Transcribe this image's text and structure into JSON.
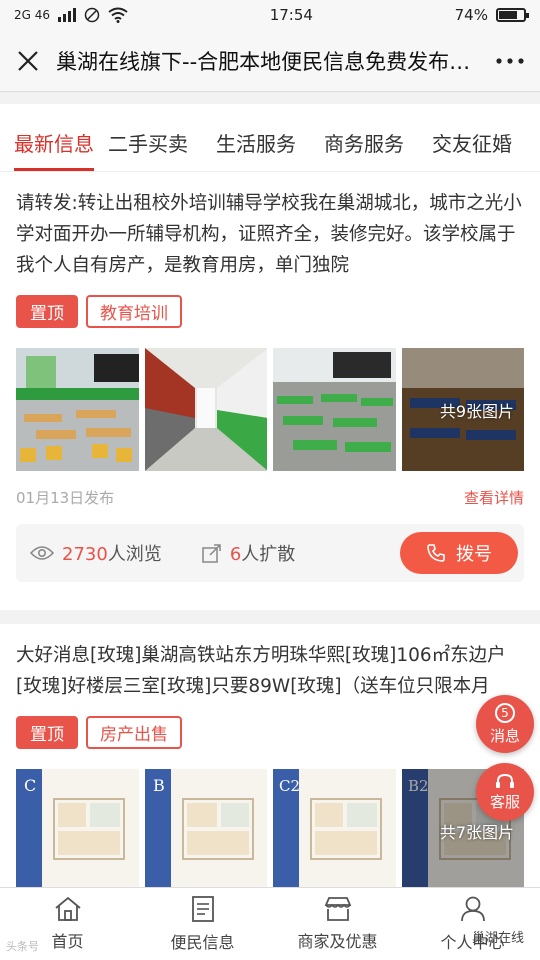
{
  "status": {
    "carrier": "2G 46",
    "time": "17:54",
    "battery": "74%",
    "battery_level": 0.74
  },
  "header": {
    "title": "巢湖在线旗下--合肥本地便民信息免费发布平台",
    "close_icon": "close-icon",
    "more_icon": "more-icon"
  },
  "tabs": [
    {
      "label": "最新信息",
      "active": true
    },
    {
      "label": "二手买卖",
      "active": false
    },
    {
      "label": "生活服务",
      "active": false
    },
    {
      "label": "商务服务",
      "active": false
    },
    {
      "label": "交友征婚",
      "active": false
    }
  ],
  "posts": [
    {
      "text": "请转发:转让出租校外培训辅导学校我在巢湖城北，城市之光小学对面开办一所辅导机构，证照齐全，装修完好。该学校属于我个人自有房产，是教育用房，单门独院",
      "tag_top": "置顶",
      "tag_category": "教育培训",
      "image_count": "共9张图片",
      "date": "01月13日发布",
      "detail_link": "查看详情",
      "views_num": "2730",
      "views_suffix": "人浏览",
      "shares_num": "6",
      "shares_suffix": "人扩散",
      "dial_label": "拨号"
    },
    {
      "text": "大好消息[玫瑰]巢湖高铁站东方明珠华熙[玫瑰]106㎡东边户[玫瑰]好楼层三室[玫瑰]只要89W[玫瑰]（送车位只限本月",
      "tag_top": "置顶",
      "tag_category": "房产出售",
      "image_count": "共7张图片",
      "plan_labels": [
        "C",
        "B",
        "C2",
        "B2"
      ]
    }
  ],
  "floating": {
    "message_count": "5",
    "message_label": "消息",
    "service_label": "客服"
  },
  "bottom_nav": [
    {
      "label": "首页",
      "icon": "home-icon"
    },
    {
      "label": "便民信息",
      "icon": "list-icon"
    },
    {
      "label": "商家及优惠",
      "icon": "store-icon"
    },
    {
      "label": "个人中心",
      "icon": "user-icon"
    }
  ],
  "watermark": "巢湖在线",
  "watermark_left": "头条号",
  "colors": {
    "accent": "#e8534a",
    "tab_active": "#d9312a"
  }
}
